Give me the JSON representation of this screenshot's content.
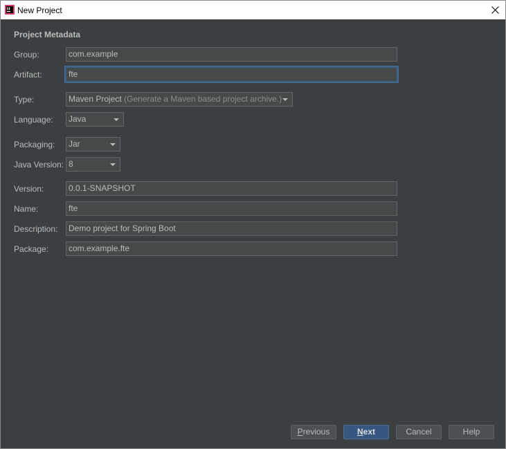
{
  "window": {
    "title": "New Project",
    "close_symbol": "✕"
  },
  "section_title": "Project Metadata",
  "fields": {
    "group": {
      "label": "Group:",
      "value": "com.example"
    },
    "artifact": {
      "label": "Artifact:",
      "value": "fte"
    },
    "type": {
      "label": "Type:",
      "value": "Maven Project",
      "hint": "(Generate a Maven based project archive.)"
    },
    "language": {
      "label": "Language:",
      "value": "Java"
    },
    "packaging": {
      "label": "Packaging:",
      "value": "Jar"
    },
    "java_version": {
      "label": "Java Version:",
      "value": "8"
    },
    "version": {
      "label": "Version:",
      "value": "0.0.1-SNAPSHOT"
    },
    "name": {
      "label": "Name:",
      "value": "fte"
    },
    "description": {
      "label": "Description:",
      "value": "Demo project for Spring Boot"
    },
    "package": {
      "label": "Package:",
      "value": "com.example.fte"
    }
  },
  "buttons": {
    "previous": {
      "mnemonic": "P",
      "rest": "revious"
    },
    "next": {
      "mnemonic": "N",
      "rest": "ext"
    },
    "cancel": "Cancel",
    "help": "Help"
  },
  "colors": {
    "background": "#3c3f41",
    "field_bg": "#45494a",
    "text": "#bbbbbb",
    "focus": "#3d6185",
    "primary_button": "#365880"
  },
  "icons": {
    "app": "intellij-idea-icon",
    "close": "close-icon",
    "dropdown": "chevron-down-icon"
  }
}
